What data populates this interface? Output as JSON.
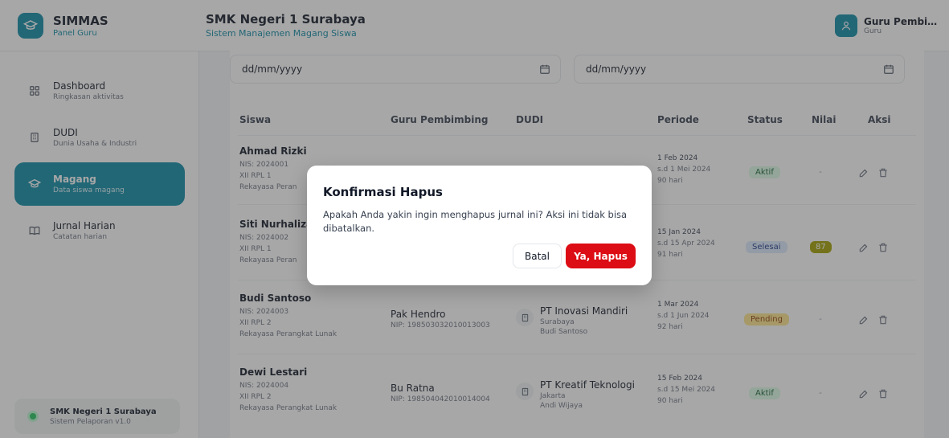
{
  "brand": {
    "title": "SIMMAS",
    "subtitle": "Panel Guru"
  },
  "school": {
    "title": "SMK Negeri 1 Surabaya",
    "subtitle": "Sistem Manajemen Magang Siswa"
  },
  "user": {
    "name": "Guru Pembimbi...",
    "role": "Guru"
  },
  "sidebar": {
    "items": [
      {
        "label": "Dashboard",
        "desc": "Ringkasan aktivitas",
        "icon": "grid-icon"
      },
      {
        "label": "DUDI",
        "desc": "Dunia Usaha & Industri",
        "icon": "building-icon"
      },
      {
        "label": "Magang",
        "desc": "Data siswa magang",
        "icon": "graduation-cap-icon",
        "active": true
      },
      {
        "label": "Jurnal Harian",
        "desc": "Catatan harian",
        "icon": "book-icon"
      }
    ],
    "footer": {
      "title": "SMK Negeri 1 Surabaya",
      "subtitle": "Sistem Pelaporan v1.0"
    }
  },
  "filters": {
    "start_date": "dd/mm/yyyy",
    "end_date": "dd/mm/yyyy"
  },
  "table": {
    "headers": [
      "Siswa",
      "Guru Pembimbing",
      "DUDI",
      "Periode",
      "Status",
      "Nilai",
      "Aksi"
    ],
    "rows": [
      {
        "name": "Ahmad Rizki",
        "nis": "NIS: 2024001",
        "kelas": "XII RPL 1",
        "jurusan": "Rekayasa Peran",
        "guru": "",
        "nip": "",
        "dudi": "",
        "kota": "",
        "pic": "",
        "start": "1 Feb 2024",
        "end": "s.d 1 Mei 2024",
        "days": "90 hari",
        "status": "Aktif",
        "nilai": "-"
      },
      {
        "name": "Siti Nurhaliza",
        "nis": "NIS: 2024002",
        "kelas": "XII RPL 1",
        "jurusan": "Rekayasa Peran",
        "guru": "",
        "nip": "",
        "dudi": "",
        "kota": "",
        "pic": "",
        "start": "15 Jan 2024",
        "end": "s.d 15 Apr 2024",
        "days": "91 hari",
        "status": "Selesai",
        "nilai": "87"
      },
      {
        "name": "Budi Santoso",
        "nis": "NIS: 2024003",
        "kelas": "XII RPL 2",
        "jurusan": "Rekayasa Perangkat Lunak",
        "guru": "Pak Hendro",
        "nip": "NIP: 198503032010013003",
        "dudi": "PT Inovasi Mandiri",
        "kota": "Surabaya",
        "pic": "Budi Santoso",
        "start": "1 Mar 2024",
        "end": "s.d 1 Jun 2024",
        "days": "92 hari",
        "status": "Pending",
        "nilai": "-"
      },
      {
        "name": "Dewi Lestari",
        "nis": "NIS: 2024004",
        "kelas": "XII RPL 2",
        "jurusan": "Rekayasa Perangkat Lunak",
        "guru": "Bu Ratna",
        "nip": "NIP: 198504042010014004",
        "dudi": "PT Kreatif Teknologi",
        "kota": "Jakarta",
        "pic": "Andi Wijaya",
        "start": "15 Feb 2024",
        "end": "s.d 15 Mei 2024",
        "days": "90 hari",
        "status": "Aktif",
        "nilai": "-"
      }
    ]
  },
  "modal": {
    "title": "Konfirmasi Hapus",
    "message": "Apakah Anda yakin ingin menghapus jurnal ini? Aksi ini tidak bisa dibatalkan.",
    "cancel_label": "Batal",
    "confirm_label": "Ya, Hapus"
  },
  "colors": {
    "accent": "#0e8aa6",
    "danger": "#dc0d14"
  }
}
